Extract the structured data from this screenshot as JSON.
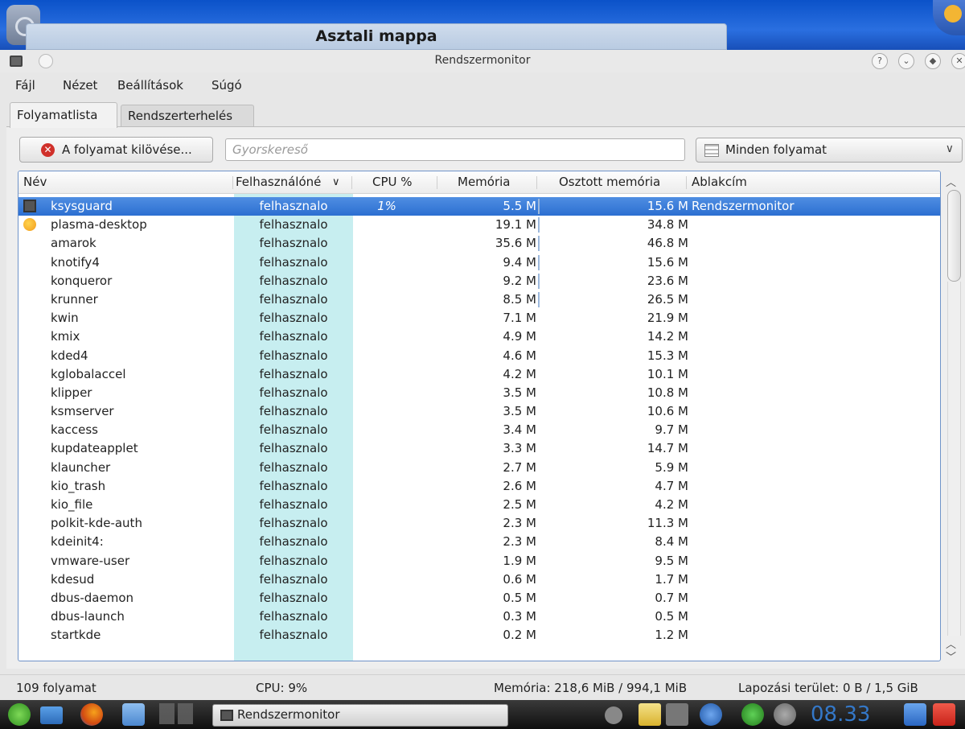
{
  "desktop": {
    "folder_title": "Asztali mappa"
  },
  "window": {
    "title": "Rendszermonitor"
  },
  "menu": [
    "Fájl",
    "Nézet",
    "Beállítások",
    "Súgó"
  ],
  "tabs": [
    "Folyamatlista",
    "Rendszerterhelés"
  ],
  "toolbar": {
    "kill_label": "A folyamat kilövése...",
    "search_placeholder": "Gyorskereső",
    "filter_value": "Minden folyamat"
  },
  "columns": [
    "Név",
    "Felhasználónév",
    "CPU %",
    "Memória",
    "Osztott memória",
    "Ablakcím"
  ],
  "columns_visible": {
    "user": "Felhasználóné"
  },
  "processes": [
    {
      "name": "ksysguard",
      "user": "felhasznalo",
      "cpu": "1%",
      "mem": "5.5 M",
      "shared": "15.6 M",
      "window": "Rendszermonitor",
      "selected": true,
      "icon": "monitor-icon"
    },
    {
      "name": "plasma-desktop",
      "user": "felhasznalo",
      "cpu": "",
      "mem": "19.1 M",
      "shared": "34.8 M",
      "window": "",
      "icon": "plasma-icon"
    },
    {
      "name": "amarok",
      "user": "felhasznalo",
      "cpu": "",
      "mem": "35.6 M",
      "shared": "46.8 M",
      "window": ""
    },
    {
      "name": "knotify4",
      "user": "felhasznalo",
      "cpu": "",
      "mem": "9.4 M",
      "shared": "15.6 M",
      "window": ""
    },
    {
      "name": "konqueror",
      "user": "felhasznalo",
      "cpu": "",
      "mem": "9.2 M",
      "shared": "23.6 M",
      "window": ""
    },
    {
      "name": "krunner",
      "user": "felhasznalo",
      "cpu": "",
      "mem": "8.5 M",
      "shared": "26.5 M",
      "window": ""
    },
    {
      "name": "kwin",
      "user": "felhasznalo",
      "cpu": "",
      "mem": "7.1 M",
      "shared": "21.9 M",
      "window": ""
    },
    {
      "name": "kmix",
      "user": "felhasznalo",
      "cpu": "",
      "mem": "4.9 M",
      "shared": "14.2 M",
      "window": ""
    },
    {
      "name": "kded4",
      "user": "felhasznalo",
      "cpu": "",
      "mem": "4.6 M",
      "shared": "15.3 M",
      "window": ""
    },
    {
      "name": "kglobalaccel",
      "user": "felhasznalo",
      "cpu": "",
      "mem": "4.2 M",
      "shared": "10.1 M",
      "window": ""
    },
    {
      "name": "klipper",
      "user": "felhasznalo",
      "cpu": "",
      "mem": "3.5 M",
      "shared": "10.8 M",
      "window": ""
    },
    {
      "name": "ksmserver",
      "user": "felhasznalo",
      "cpu": "",
      "mem": "3.5 M",
      "shared": "10.6 M",
      "window": ""
    },
    {
      "name": "kaccess",
      "user": "felhasznalo",
      "cpu": "",
      "mem": "3.4 M",
      "shared": "9.7 M",
      "window": ""
    },
    {
      "name": "kupdateapplet",
      "user": "felhasznalo",
      "cpu": "",
      "mem": "3.3 M",
      "shared": "14.7 M",
      "window": ""
    },
    {
      "name": "klauncher",
      "user": "felhasznalo",
      "cpu": "",
      "mem": "2.7 M",
      "shared": "5.9 M",
      "window": ""
    },
    {
      "name": "kio_trash",
      "user": "felhasznalo",
      "cpu": "",
      "mem": "2.6 M",
      "shared": "4.7 M",
      "window": ""
    },
    {
      "name": "kio_file",
      "user": "felhasznalo",
      "cpu": "",
      "mem": "2.5 M",
      "shared": "4.2 M",
      "window": ""
    },
    {
      "name": "polkit-kde-auth",
      "user": "felhasznalo",
      "cpu": "",
      "mem": "2.3 M",
      "shared": "11.3 M",
      "window": ""
    },
    {
      "name": "kdeinit4:",
      "user": "felhasznalo",
      "cpu": "",
      "mem": "2.3 M",
      "shared": "8.4 M",
      "window": ""
    },
    {
      "name": "vmware-user",
      "user": "felhasznalo",
      "cpu": "",
      "mem": "1.9 M",
      "shared": "9.5 M",
      "window": ""
    },
    {
      "name": "kdesud",
      "user": "felhasznalo",
      "cpu": "",
      "mem": "0.6 M",
      "shared": "1.7 M",
      "window": ""
    },
    {
      "name": "dbus-daemon",
      "user": "felhasznalo",
      "cpu": "",
      "mem": "0.5 M",
      "shared": "0.7 M",
      "window": ""
    },
    {
      "name": "dbus-launch",
      "user": "felhasznalo",
      "cpu": "",
      "mem": "0.3 M",
      "shared": "0.5 M",
      "window": ""
    },
    {
      "name": "startkde",
      "user": "felhasznalo",
      "cpu": "",
      "mem": "0.2 M",
      "shared": "1.2 M",
      "window": ""
    }
  ],
  "status": {
    "process_count": "109 folyamat",
    "cpu": "CPU: 9%",
    "memory": "Memória: 218,6 MiB / 994,1 MiB",
    "swap": "Lapozási terület: 0 B / 1,5 GiB"
  },
  "taskbar": {
    "task_label": "Rendszermonitor",
    "clock": "08.33"
  },
  "colors": {
    "selection": "#3a7ed8",
    "user_column": "#c7eef0",
    "frame": "#6f93c9"
  }
}
